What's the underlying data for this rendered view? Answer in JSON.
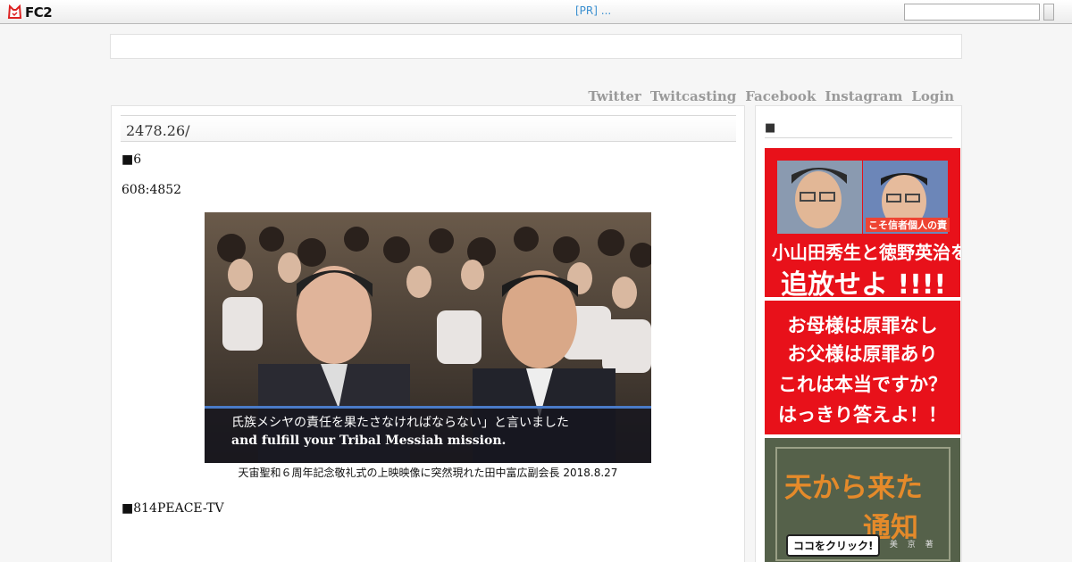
{
  "topbar": {
    "logo_text": "FC2",
    "pr_text": "[PR] ...",
    "search_value": ""
  },
  "nav": {
    "links": [
      "Twitter",
      "Twitcasting",
      "Facebook",
      "Instagram",
      "Login"
    ]
  },
  "entry": {
    "title": "2478.26/",
    "line1": "■6",
    "line2": "608:4852",
    "video_subtitle_jp": "氏族メシヤの責任を果たさなければならない」と言いました",
    "video_subtitle_en": "and fulfill your Tribal Messiah mission.",
    "video_credit": "天宙聖和６周年記念敬礼式の上映映像に突然現れた田中富広副会長 2018.8.27",
    "line3": "■814PEACE-TV"
  },
  "sidebar": {
    "title": "■",
    "banner1": {
      "tag": "こそ信者個人の責",
      "names": "小山田秀生と徳野英治を",
      "call": "追放せよ !!!!"
    },
    "banner2": {
      "lines": [
        "お母様は原罪なし",
        "お父様は原罪あり",
        "これは本当ですか？",
        "はっきり答えよ！！"
      ]
    },
    "banner3": {
      "title1": "天から来た",
      "title2": "通知",
      "author": "金 美 京 著",
      "click": "ココをクリック!"
    }
  },
  "colors": {
    "banner_red": "#e8111a",
    "nav_gray": "#9a9a9a",
    "pr_blue": "#3a8fd0"
  }
}
